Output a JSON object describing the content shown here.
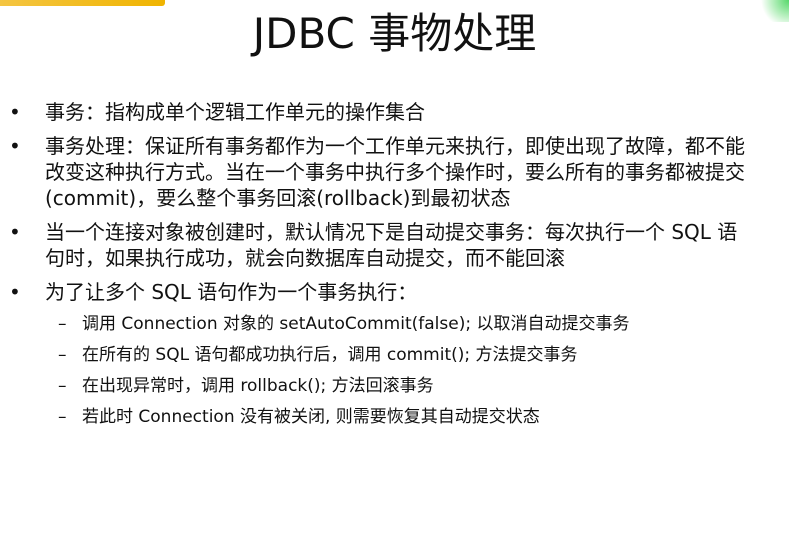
{
  "slide": {
    "title": "JDBC 事物处理",
    "bullets": [
      {
        "marker": "•",
        "text": "事务：指构成单个逻辑工作单元的操作集合"
      },
      {
        "marker": "•",
        "text": "事务处理：保证所有事务都作为一个工作单元来执行，即使出现了故障，都不能改变这种执行方式。当在一个事务中执行多个操作时，要么所有的事务都被提交(commit)，要么整个事务回滚(rollback)到最初状态"
      },
      {
        "marker": "•",
        "text": "当一个连接对象被创建时，默认情况下是自动提交事务：每次执行一个 SQL 语句时，如果执行成功，就会向数据库自动提交，而不能回滚"
      },
      {
        "marker": "•",
        "text": "为了让多个 SQL 语句作为一个事务执行："
      }
    ],
    "sub_items": [
      {
        "marker": "–",
        "text": "调用 Connection 对象的 setAutoCommit(false); 以取消自动提交事务"
      },
      {
        "marker": "–",
        "text": "在所有的 SQL 语句都成功执行后，调用 commit(); 方法提交事务"
      },
      {
        "marker": "–",
        "text": "在出现异常时，调用 rollback(); 方法回滚事务"
      },
      {
        "marker": "–",
        "text": "若此时 Connection 没有被关闭, 则需要恢复其自动提交状态"
      }
    ]
  }
}
